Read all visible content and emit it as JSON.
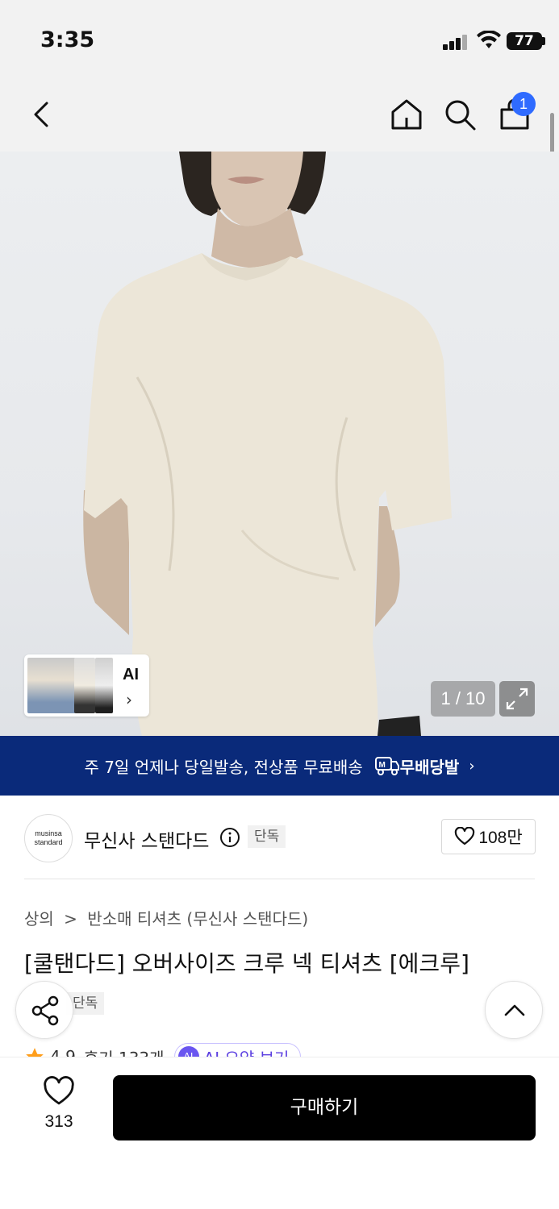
{
  "status_bar": {
    "time": "3:35",
    "battery": "77"
  },
  "nav": {
    "cart_count": "1"
  },
  "gallery": {
    "ai_label": "AI",
    "counter": "1 / 10"
  },
  "promo": {
    "text": "주 7일 언제나 당일발송, 전상품 무료배송",
    "logo_text": "무배당발"
  },
  "brand": {
    "logo_line1": "musinsa",
    "logo_line2": "standard",
    "name": "무신사 스탠다드",
    "exclusive": "단독",
    "likes": "108만"
  },
  "product": {
    "breadcrumb": [
      "상의",
      ">",
      "반소매 티셔츠 (무신사 스탠다드)"
    ],
    "title": "[쿨탠다드] 오버사이즈 크루 넥 티셔츠 [에크루]",
    "badge": "단독",
    "rating": "4.9",
    "reviews": "후기 133개",
    "ai_summary": "AI 요약 보기",
    "ai_chip_icon_text": "AI"
  },
  "bottom": {
    "wish_count": "313",
    "buy_label": "구매하기"
  },
  "colors": {
    "promo_bg": "#0a2a7a",
    "badge_blue": "#2f6bff",
    "buy_bg": "#000000",
    "star": "#ff9e1b",
    "ai_purple": "#5b3fe0"
  }
}
